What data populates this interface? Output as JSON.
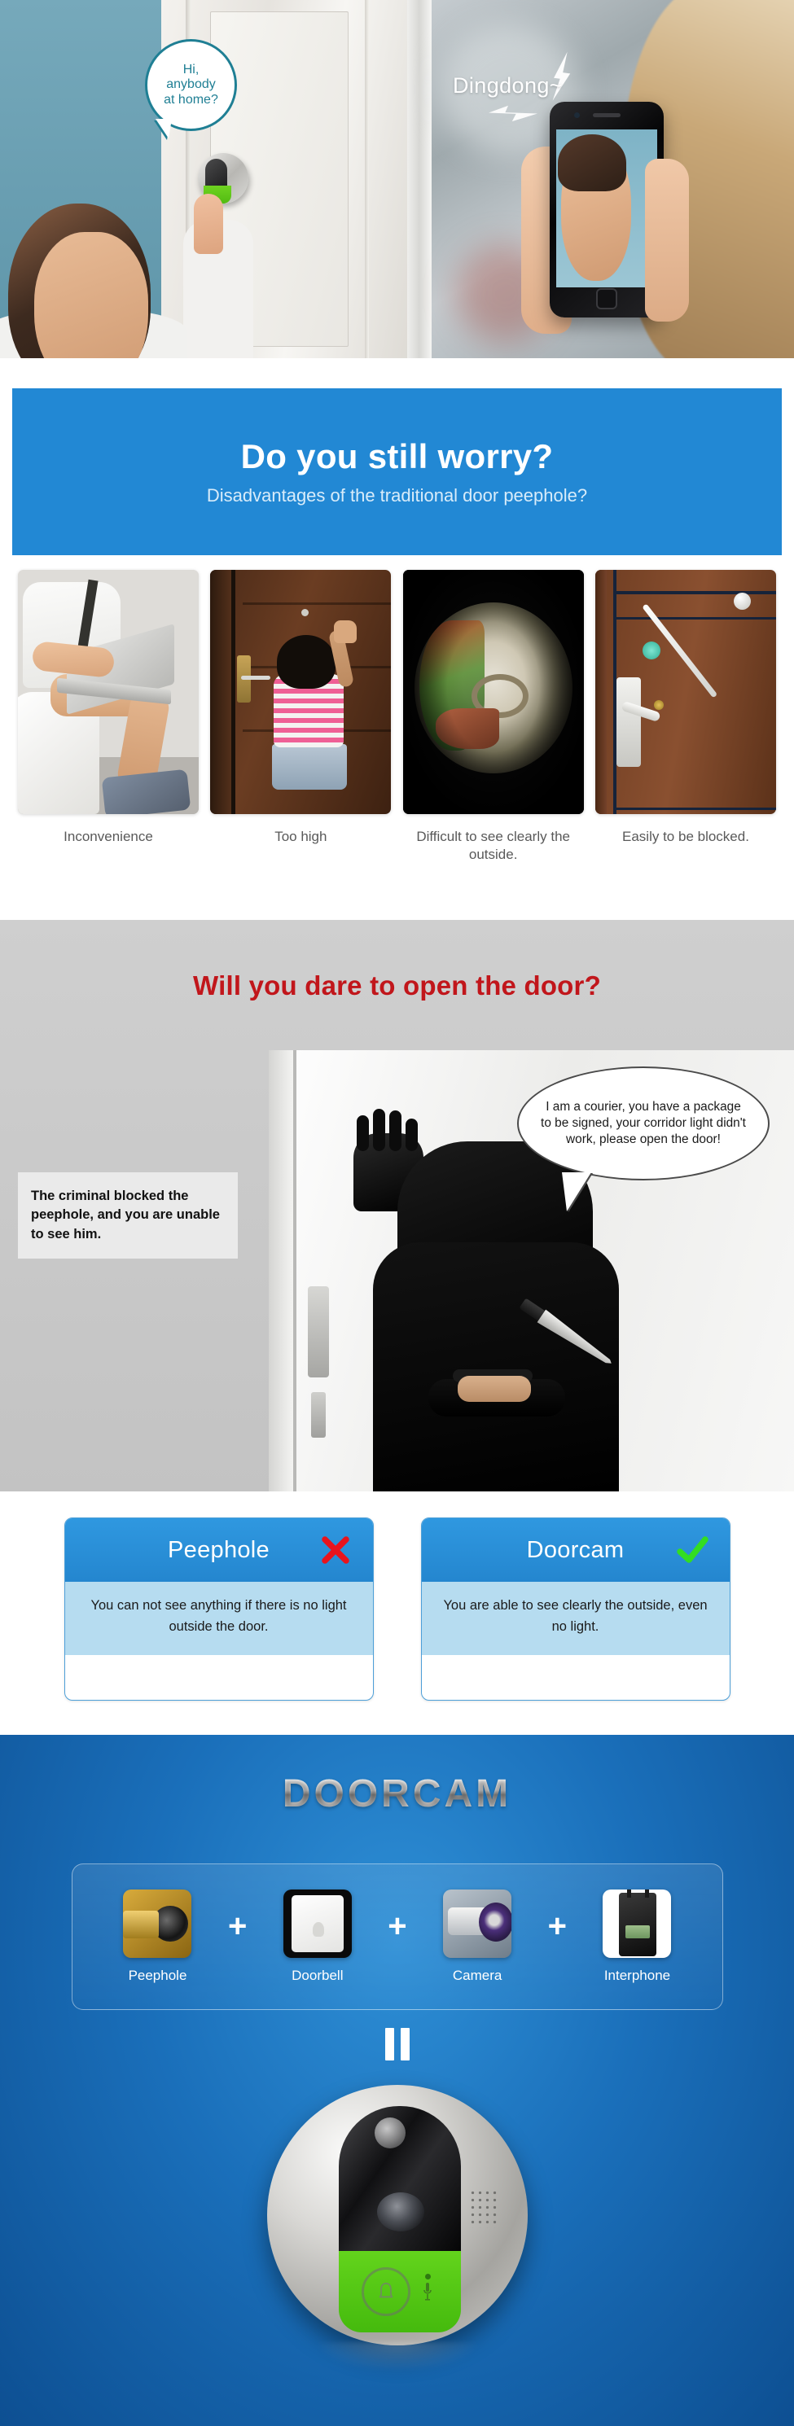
{
  "hero": {
    "left": {
      "bubble_text": "Hi,\nanybody\nat home?",
      "bubble_lines": [
        "Hi,",
        "anybody",
        "at home?"
      ]
    },
    "right": {
      "sound_label": "Dingdong~"
    }
  },
  "banner": {
    "title": "Do you still worry?",
    "subtitle": "Disadvantages of the traditional door peephole?",
    "bg_color": "#2288d4"
  },
  "problems": [
    {
      "caption": "Inconvenience",
      "icon": "toilet-laptop-photo"
    },
    {
      "caption": "Too high",
      "icon": "child-at-door-photo"
    },
    {
      "caption": "Difficult to see clearly the outside.",
      "icon": "dark-fisheye-photo"
    },
    {
      "caption": "Easily to be blocked.",
      "icon": "blocked-peephole-photo"
    }
  ],
  "danger": {
    "heading": "Will you dare to open the door?",
    "heading_color": "#c1161b",
    "note": "The criminal blocked the peephole, and you are unable to see him.",
    "speech": "I am a courier, you have a package to be signed, your corridor light didn't work, please open the door!"
  },
  "compare": [
    {
      "title": "Peephole",
      "mark": "cross-icon",
      "mark_color": "#e8141d",
      "body": "You can not see anything if there is no light outside the door."
    },
    {
      "title": "Doorcam",
      "mark": "check-icon",
      "mark_color": "#33dd22",
      "body": "You are able to see clearly the outside, even no light."
    }
  ],
  "product": {
    "title": "DOORCAM",
    "equation_items": [
      {
        "label": "Peephole",
        "icon": "brass-peephole-image"
      },
      {
        "label": "Doorbell",
        "icon": "wall-doorbell-image"
      },
      {
        "label": "Camera",
        "icon": "bullet-camera-image"
      },
      {
        "label": "Interphone",
        "icon": "walkie-talkie-image"
      }
    ],
    "operator_plus": "+",
    "operator_equals": "=",
    "device": {
      "name": "doorcam-device",
      "button_icon": "bell-icon",
      "mic_icon": "microphone-icon",
      "speaker_icon": "speaker-grille-icon",
      "accent_color": "#52c413"
    }
  }
}
